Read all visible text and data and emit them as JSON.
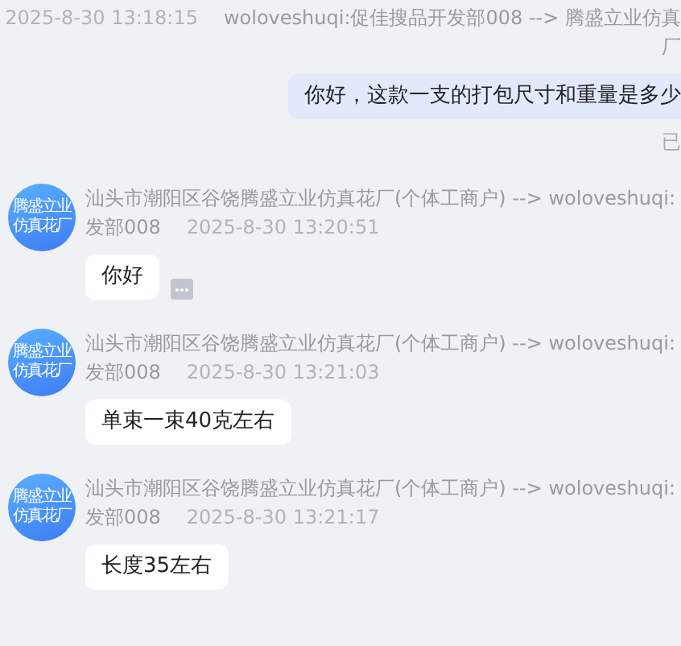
{
  "outgoing": {
    "time": "2025-8-30 13:18:15",
    "sender": "woloveshuqi:促佳搜品开发部008 --> 腾盛立业仿真",
    "sender_cont": "厂",
    "text": "你好，这款一支的打包尺寸和重量是多少",
    "status": "已"
  },
  "incoming": [
    {
      "avatar": [
        "腾盛立业",
        "仿真花厂"
      ],
      "sender": "汕头市潮阳区谷饶腾盛立业仿真花厂(个体工商户) --> woloveshuqi:",
      "sender_cont": "发部008",
      "time": "2025-8-30 13:20:51",
      "text": "你好",
      "more": true
    },
    {
      "avatar": [
        "腾盛立业",
        "仿真花厂"
      ],
      "sender": "汕头市潮阳区谷饶腾盛立业仿真花厂(个体工商户) --> woloveshuqi:",
      "sender_cont": "发部008",
      "time": "2025-8-30 13:21:03",
      "text": "单束一束40克左右",
      "more": false
    },
    {
      "avatar": [
        "腾盛立业",
        "仿真花厂"
      ],
      "sender": "汕头市潮阳区谷饶腾盛立业仿真花厂(个体工商户) --> woloveshuqi:",
      "sender_cont": "发部008",
      "time": "2025-8-30 13:21:17",
      "text": "长度35左右",
      "more": false
    }
  ]
}
